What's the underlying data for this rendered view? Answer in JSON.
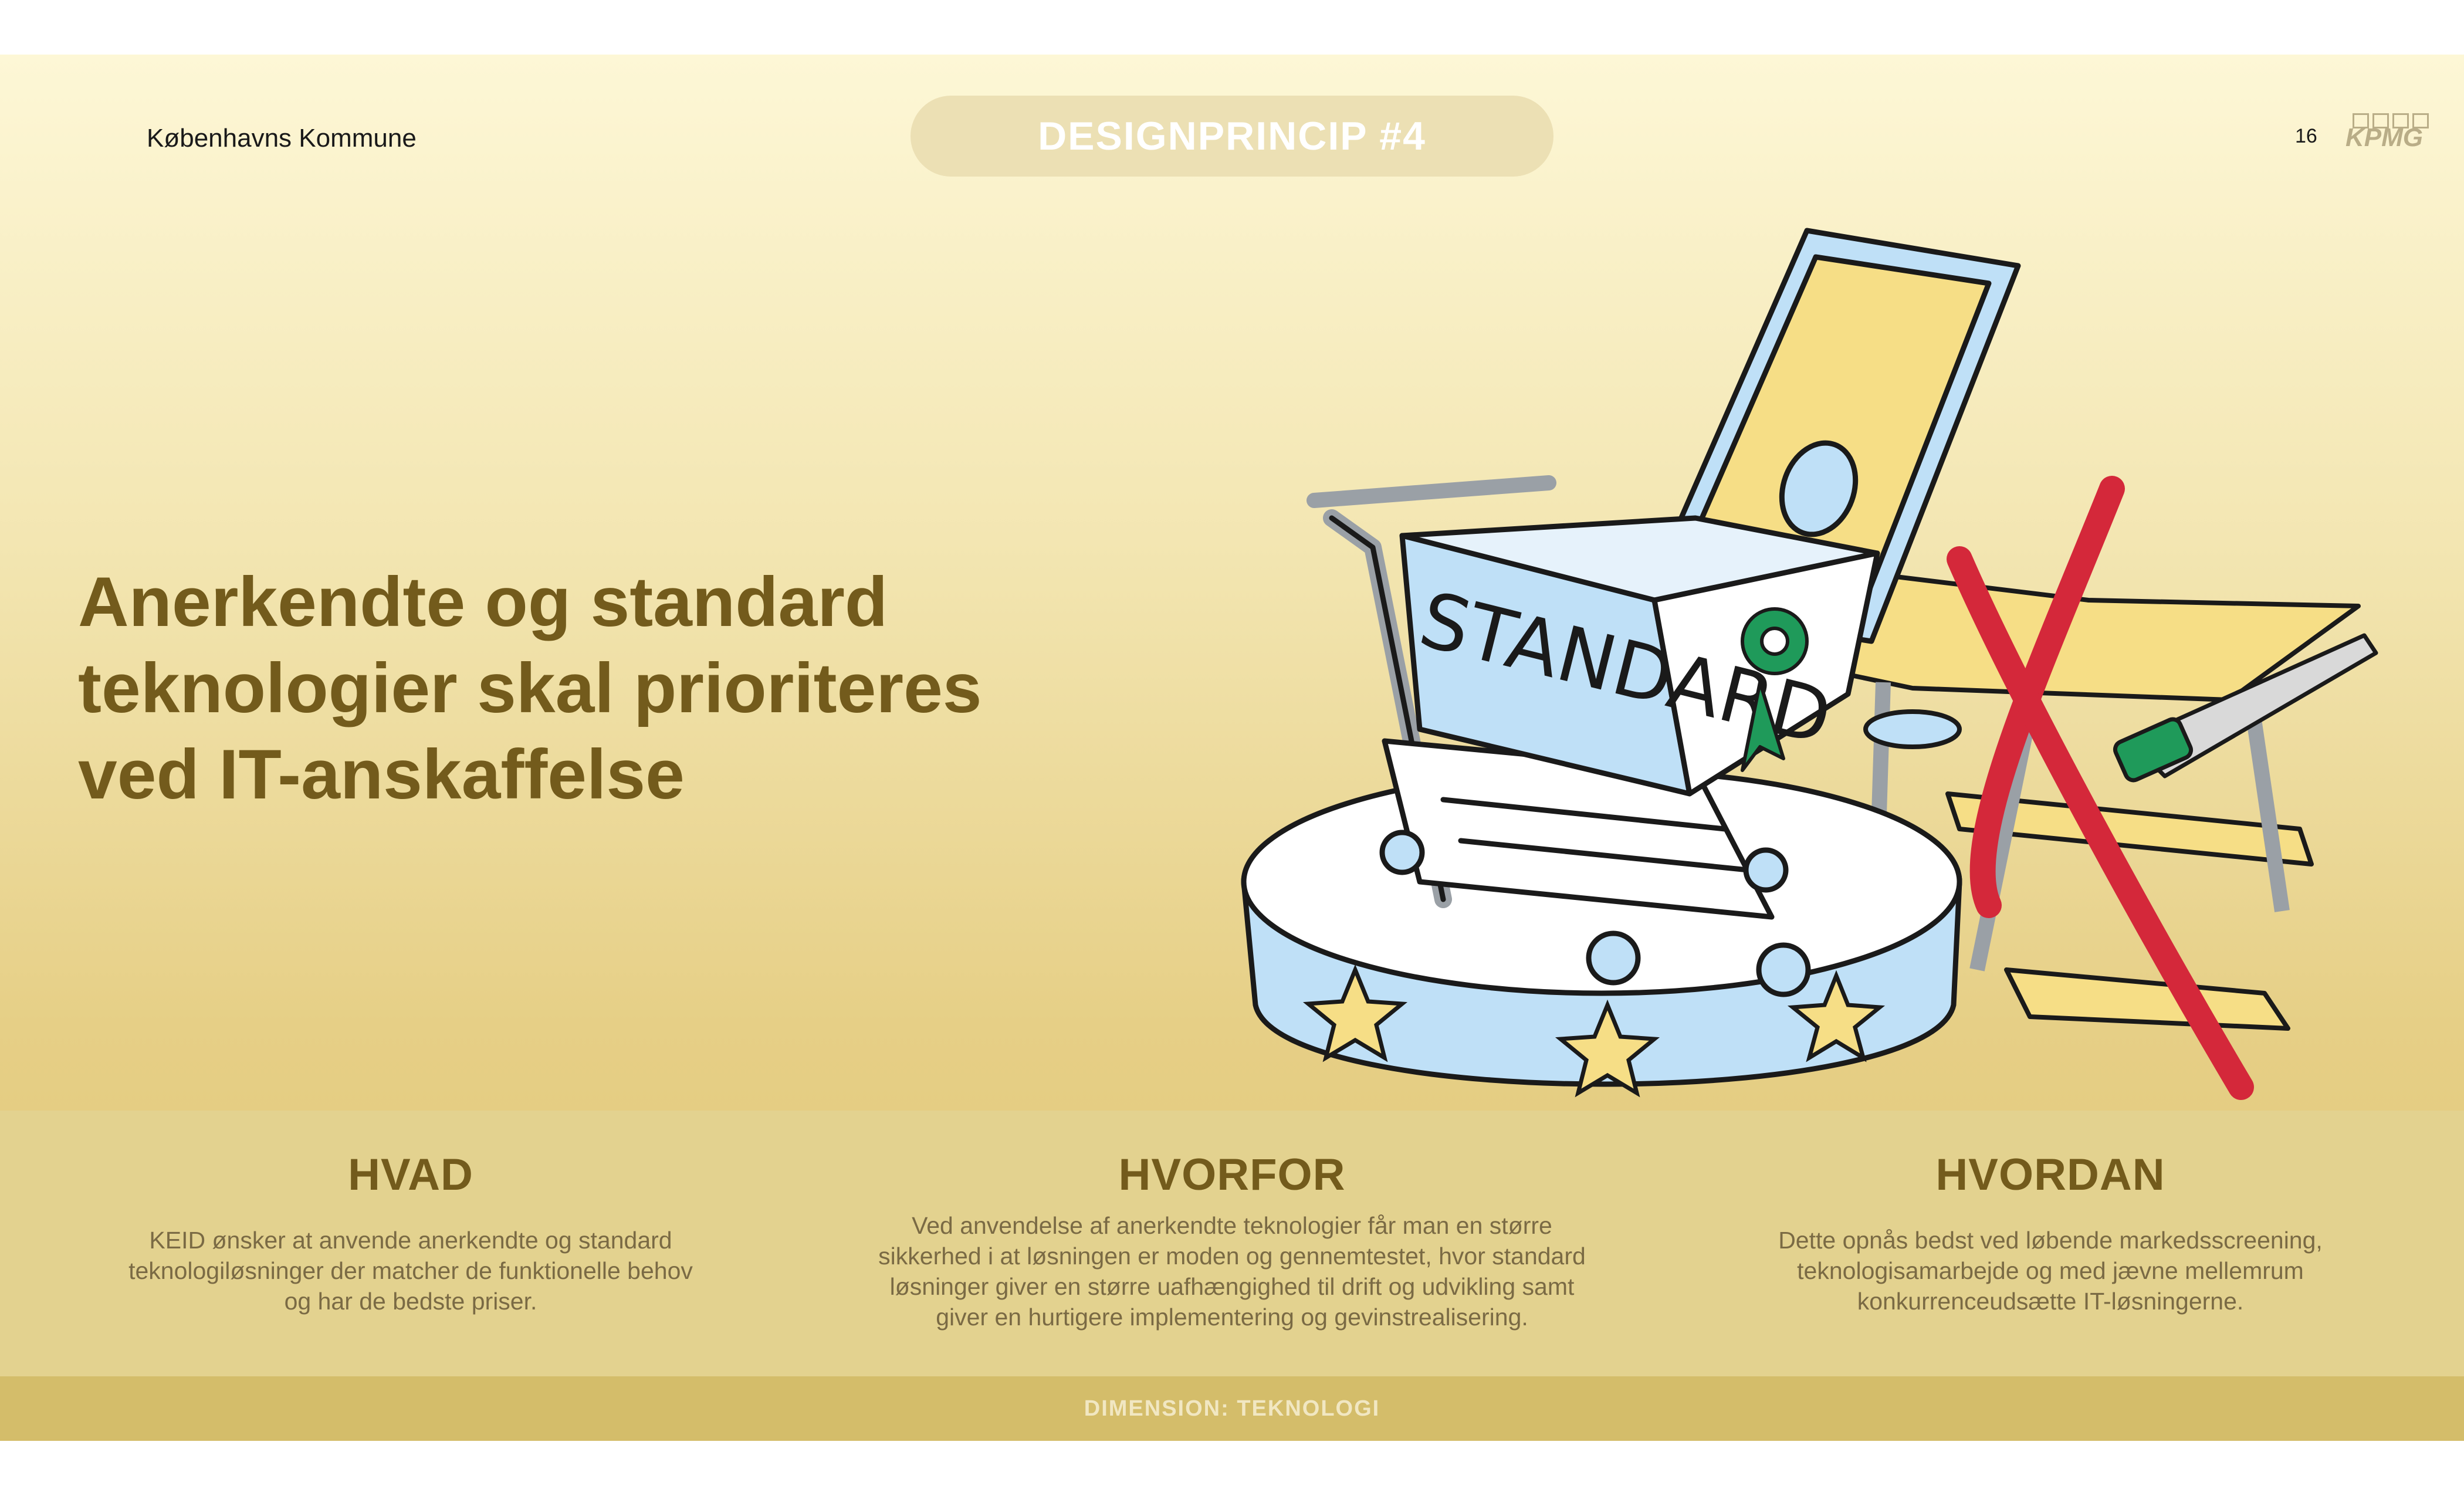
{
  "header": {
    "organization": "Københavns Kommune",
    "principle_pill": "DESIGNPRINCIP #4",
    "page_number": "16",
    "logo_text": "KPMG"
  },
  "headline": {
    "line1": "Anerkendte og standard",
    "line2": "teknologier skal prioriteres",
    "line3": "ved IT-anskaffelse"
  },
  "illustration": {
    "cart_label": "STANDARD",
    "icons": [
      "shopping-cart-icon",
      "pedestal-icon",
      "star-icon",
      "rosette-icon",
      "saw-icon",
      "red-x-icon"
    ],
    "colors": {
      "light_blue": "#bfe0f7",
      "yellow": "#f6de86",
      "red": "#d4283a",
      "green": "#1f9a5a"
    }
  },
  "columns": [
    {
      "heading": "HVAD",
      "lines": [
        "KEID ønsker at anvende anerkendte og standard",
        "teknologiløsninger der matcher de funktionelle behov",
        "og har de bedste priser."
      ]
    },
    {
      "heading": "HVORFOR",
      "lines": [
        "Ved anvendelse af anerkendte teknologier får man en større",
        "sikkerhed i at løsningen er moden og gennemtestet, hvor standard",
        "løsninger giver en større uafhængighed til drift og udvikling samt",
        "giver en hurtigere implementering og gevinstrealisering."
      ]
    },
    {
      "heading": "HVORDAN",
      "lines": [
        "Dette opnås bedst ved løbende markedsscreening,",
        "teknologisamarbejde og med jævne mellemrum",
        "konkurrenceudsætte IT-løsningerne."
      ]
    }
  ],
  "footer": {
    "dimension": "DIMENSION: TEKNOLOGI"
  },
  "colors": {
    "headline": "#735b1c",
    "band": "#e3d28f",
    "footer": "#d4bd6a",
    "pill": "#ece0b4"
  }
}
